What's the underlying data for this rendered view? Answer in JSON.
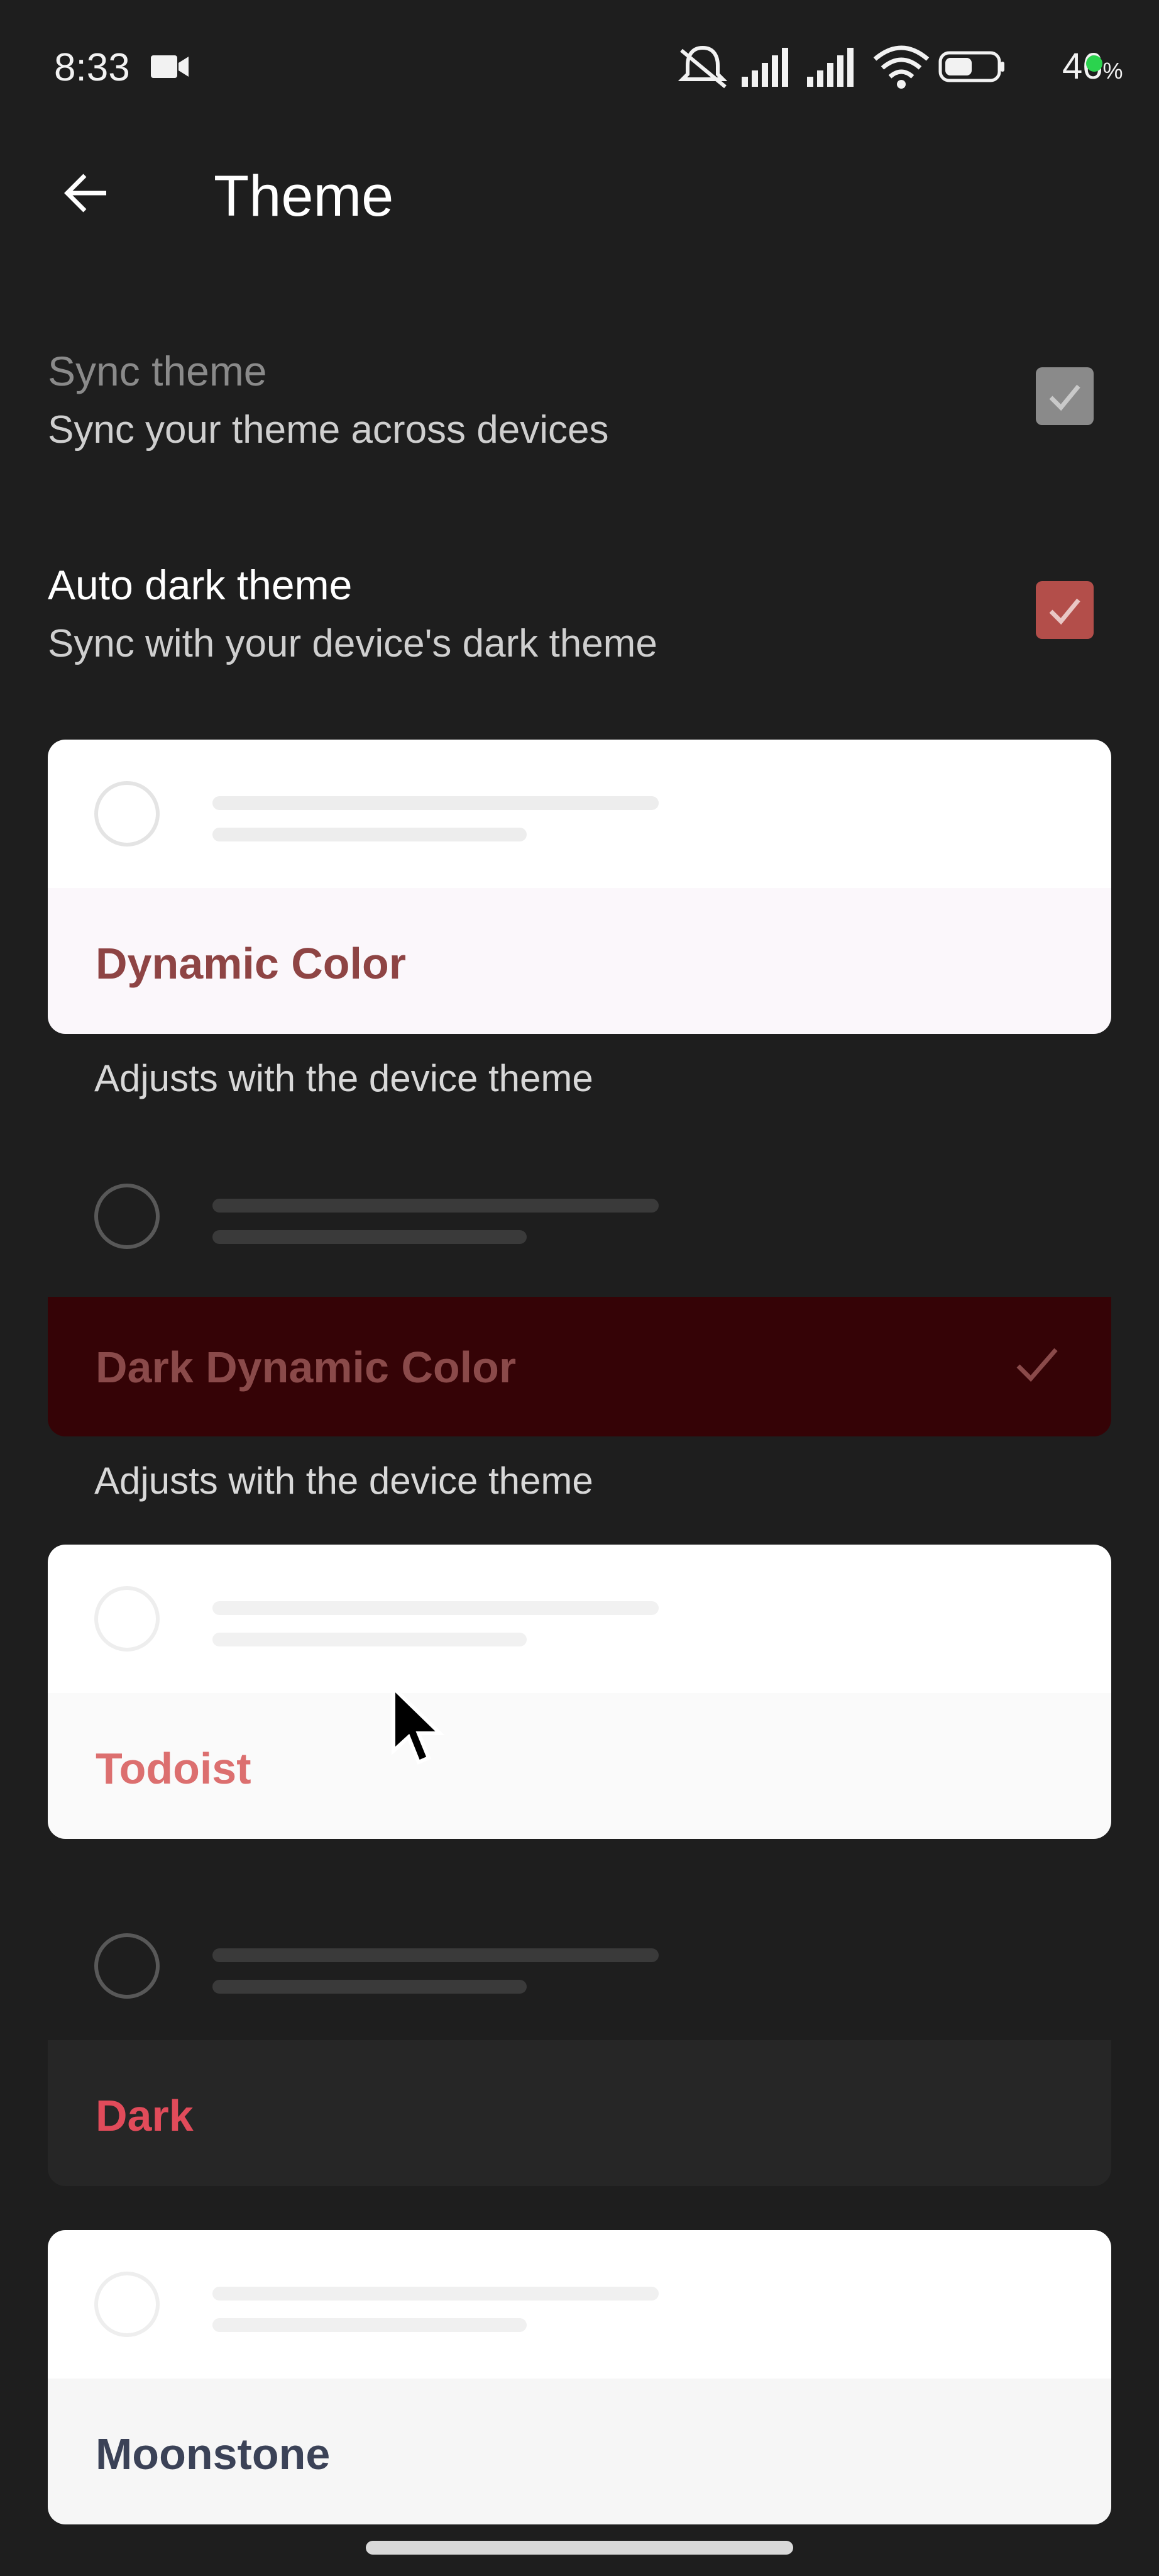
{
  "status_bar": {
    "time": "8:33",
    "battery": "46",
    "battery_unit": "%",
    "icons": [
      "video-camera-icon",
      "mute-icon",
      "signal-icon",
      "signal-icon",
      "wifi-icon",
      "battery-icon"
    ]
  },
  "app_bar": {
    "title": "Theme",
    "back_icon": "arrow-left-icon"
  },
  "settings": {
    "sync": {
      "title": "Sync theme",
      "subtitle": "Sync your theme across devices",
      "checked": true,
      "enabled": false
    },
    "auto_dark": {
      "title": "Auto dark theme",
      "subtitle": "Sync with your device's dark theme",
      "checked": true,
      "enabled": true
    }
  },
  "themes": [
    {
      "name": "Dynamic Color",
      "description": "Adjusts with the device theme",
      "selected": false,
      "name_color": "#8e4444"
    },
    {
      "name": "Dark Dynamic Color",
      "description": "Adjusts with the device theme",
      "selected": true,
      "name_color": "#8a4a4a"
    },
    {
      "name": "Todoist",
      "selected": false,
      "name_color": "#dc6f6f"
    },
    {
      "name": "Dark",
      "selected": false,
      "name_color": "#e14b5a"
    },
    {
      "name": "Moonstone",
      "selected": false,
      "name_color": "#3b4257"
    }
  ],
  "colors": {
    "background": "#1e1e1e",
    "checkbox_active": "#b34e4a",
    "checkbox_disabled": "#8a8a8a",
    "dark_dynamic_band": "#350306"
  }
}
